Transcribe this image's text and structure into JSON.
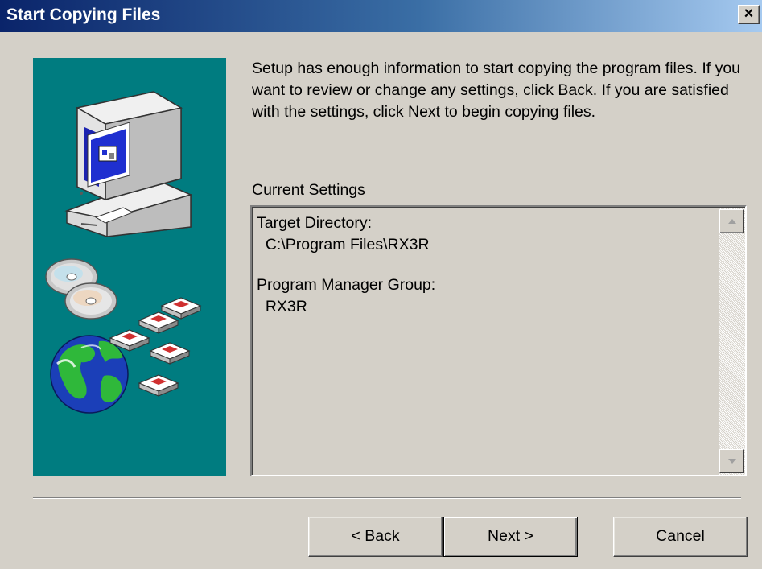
{
  "window": {
    "title": "Start Copying Files",
    "close_glyph": "×"
  },
  "intro_text": "Setup has enough information to start copying the program files. If you want to review or change any settings, click Back. If you are satisfied with the settings, click Next to begin copying files.",
  "current_settings": {
    "label": "Current Settings",
    "lines": [
      "Target Directory:",
      "  C:\\Program Files\\RX3R",
      "",
      "Program Manager Group:",
      "  RX3R"
    ]
  },
  "buttons": {
    "back": "< Back",
    "next": "Next >",
    "cancel": "Cancel"
  },
  "icons": {
    "side_panel": [
      "computer-icon",
      "cd-disc-icon",
      "globe-icon",
      "floppy-disk-icon"
    ],
    "scroll_up": "arrow-up-icon",
    "scroll_down": "arrow-down-icon"
  },
  "colors": {
    "title_bar_start": "#0a246a",
    "title_bar_end": "#a6caf0",
    "side_panel": "#007c80",
    "dialog_face": "#d4d0c8"
  }
}
